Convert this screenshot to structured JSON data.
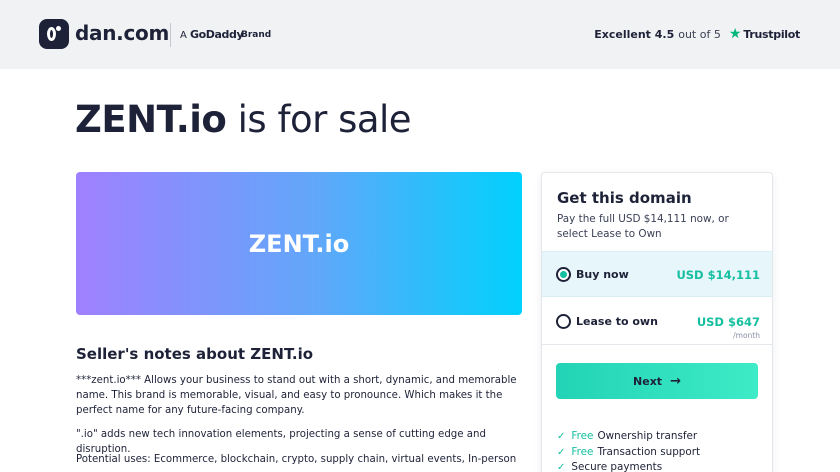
{
  "header": {
    "logo_text": "dan.com",
    "brand_prefix": "A",
    "brand_name": "GoDaddy",
    "brand_suffix": "Brand",
    "rating_label": "Excellent 4.5",
    "rating_outof": "out of 5",
    "trustpilot": "Trustpilot",
    "star_color": "#00b67a"
  },
  "hero": {
    "domain": "ZENT.io",
    "suffix": "is for sale",
    "banner_text": "ZENT.io"
  },
  "notes": {
    "title": "Seller's notes about ZENT.io",
    "paragraphs": [
      "***zent.io*** Allows your business to stand out with a short, dynamic, and memorable name. This brand is memorable, visual, and easy to pronounce. Which makes it the perfect name for any future-facing company.",
      "\".io\" adds new tech innovation elements, projecting a sense of cutting edge and disruption.",
      "Potential uses: Ecommerce, blockchain, crypto, supply chain, virtual events, In-person"
    ]
  },
  "purchase": {
    "title": "Get this domain",
    "subtitle": "Pay the full USD $14,111 now, or select Lease to Own",
    "options": [
      {
        "label": "Buy now",
        "price": "USD $14,111",
        "period": ""
      },
      {
        "label": "Lease to own",
        "price": "USD $647",
        "period": "/month"
      }
    ],
    "next_label": "Next",
    "perks": [
      {
        "free": "Free",
        "text": "Ownership transfer"
      },
      {
        "free": "Free",
        "text": "Transaction support"
      },
      {
        "free": "",
        "text": "Secure payments"
      }
    ],
    "accent_color": "#15bfa0"
  }
}
